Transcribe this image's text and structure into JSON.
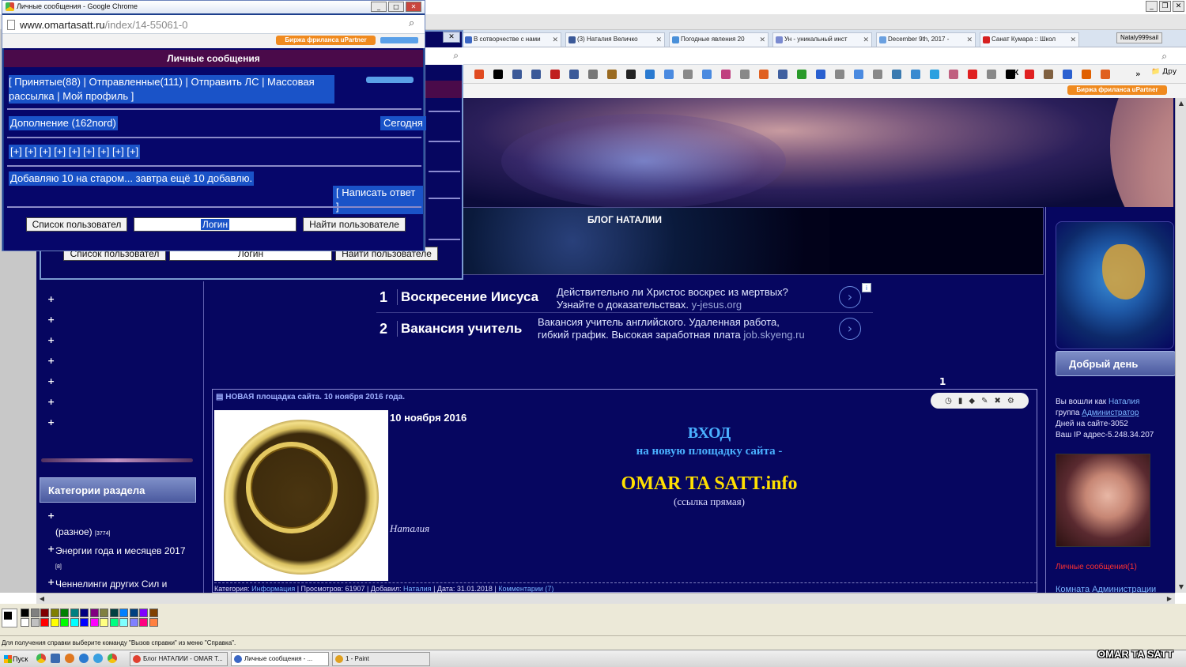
{
  "popup": {
    "window_title": "Личные сообщения - Google Chrome",
    "url_host": "www.omartasatt.ru",
    "url_path": "/index/14-55061-0",
    "upartner_label": "Биржа фриланса uPartner",
    "header": "Личные сообщения",
    "nav_text": "[ Принятые(88) | Отправленные(111) | Отправить ЛС | Массовая рассылка | Мой профиль ]",
    "sender": "Дополнение   (162nord)",
    "date": "Сегодня",
    "plus_links": "[+] [+] [+] [+] [+] [+] [+] [+] [+]",
    "message": "Добавляю 10 на старом... завтра ещё 10 добавлю.",
    "reply_button": "[ Написать ответ ]",
    "user_list_button": "Список пользовател",
    "login_placeholder": "Логин",
    "find_user_button": "Найти пользователе"
  },
  "behind_popup": {
    "user_list_button": "Список пользовател",
    "login_placeholder": "Логин",
    "find_user_button": "Найти пользователе"
  },
  "browser": {
    "tabs": [
      {
        "label": "В сотворчестве с нами",
        "color": "#3b67c4"
      },
      {
        "label": "(3) Наталия Величко",
        "color": "#3b5998"
      },
      {
        "label": "Погодные явления 20",
        "color": "#4a90d9"
      },
      {
        "label": "Ун - уникальный инст",
        "color": "#7a8ad0"
      },
      {
        "label": "December 9th, 2017 -",
        "color": "#6aa0e0"
      },
      {
        "label": "Санат Кумара :: Школ",
        "color": "#d62020"
      }
    ],
    "user_badge": "Nataly999sail",
    "upartner_label": "Биржа фриланса uPartner",
    "bookmarks_folder": "Дру",
    "bookmark_ek": "ЭК"
  },
  "site": {
    "blog_title": "БЛОГ НАТАЛИИ",
    "left_plus": [
      "+",
      "+",
      "+",
      "+",
      "+",
      "+",
      "+"
    ],
    "categories_header": "Категории раздела",
    "categories": [
      {
        "plus": "+",
        "label": "(разное)",
        "count": "[3774]"
      },
      {
        "plus": "+",
        "label": "Энергии года и месяцев 2017",
        "count": "[8]"
      },
      {
        "plus": "+",
        "label": "Ченнелинги других Сил и",
        "count": ""
      }
    ],
    "ads": [
      {
        "num": "1",
        "title": "Воскресение Иисуса",
        "desc1": "Действительно ли Христос воскрес из мертвых?",
        "desc2": "Узнайте о доказательствах.",
        "domain": "y-jesus.org"
      },
      {
        "num": "2",
        "title": "Вакансия учитель",
        "desc1": "Вакансия учитель английского. Удаленная работа,",
        "desc2": "гибкий график. Высокая заработная плата",
        "domain": "job.skyeng.ru"
      }
    ],
    "ad_arrow": "›",
    "ad_info": "i",
    "page_number": "1",
    "post": {
      "header": "НОВАЯ площадка сайта. 10 ноября 2016 года.",
      "date": "10 ноября 2016",
      "vhod": "ВХОД",
      "subtitle": "на новую площадку сайта -",
      "site_name": "OMAR TA SATT.info",
      "link_note": "(ссылка прямая)",
      "author": "Наталия",
      "footer": {
        "cat_label": "Категория:",
        "cat_value": "Информация",
        "views": "| Просмотров: 61907 | Добавил:",
        "author": "Наталия",
        "date": "| Дата: 31.01.2018 |",
        "comments": "Комментарии (7)"
      }
    },
    "good_day": "Добрый день",
    "sidebar_info": {
      "logged_as": "Вы вошли как",
      "user": "Наталия",
      "group_label": "группа",
      "group": "Администратор",
      "days": "Дней на сайте-3052",
      "ip": "Ваш IP адрес-5.248.34.207"
    },
    "private_messages": "Личные сообщения(1)",
    "admin_room": "Комната Администрации"
  },
  "paint": {
    "status_help": "Для получения справки выберите команду \"Вызов справки\" из меню \"Справка\".",
    "palette_colors": [
      "#000000",
      "#808080",
      "#800000",
      "#808000",
      "#008000",
      "#008080",
      "#000080",
      "#800080",
      "#808040",
      "#004040",
      "#0080ff",
      "#004080",
      "#8000ff",
      "#804000",
      "#ffffff",
      "#c0c0c0",
      "#ff0000",
      "#ffff00",
      "#00ff00",
      "#00ffff",
      "#0000ff",
      "#ff00ff",
      "#ffff80",
      "#00ff80",
      "#80ffff",
      "#8080ff",
      "#ff0080",
      "#ff8040"
    ]
  },
  "taskbar": {
    "start": "Пуск",
    "tasks": [
      {
        "label": "Блог НАТАЛИИ - OMAR T...",
        "color": "#e04030",
        "active": false
      },
      {
        "label": "Личные сообщения - ...",
        "color": "#3b67c4",
        "active": true
      },
      {
        "label": "1 - Paint",
        "color": "#e0a020",
        "active": false
      }
    ]
  },
  "watermark": "OMAR TA SATT"
}
